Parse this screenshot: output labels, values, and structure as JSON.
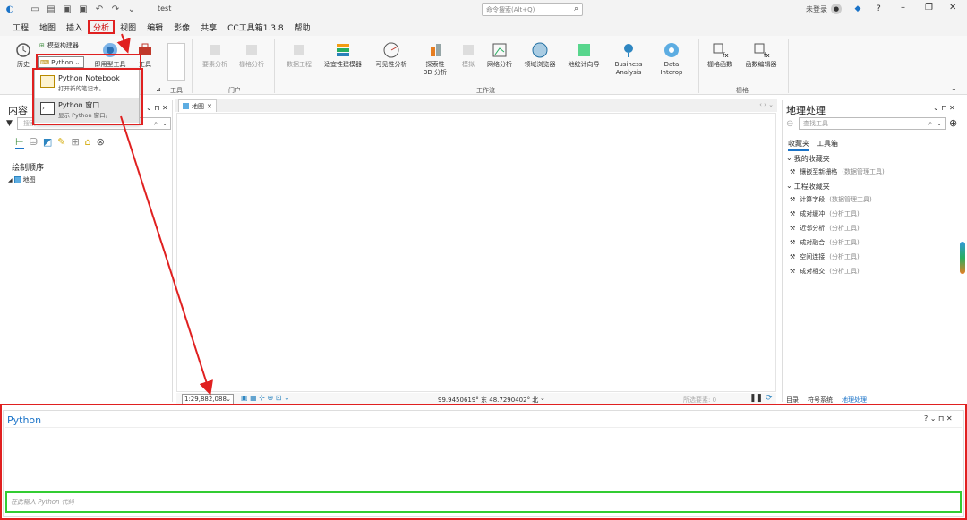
{
  "titlebar": {
    "doc_title": "test",
    "search_placeholder": "命令搜索(Alt+Q)",
    "login": "未登录",
    "help": "?"
  },
  "menubar": {
    "items": [
      "工程",
      "地图",
      "插入",
      "分析",
      "视图",
      "编辑",
      "影像",
      "共享",
      "CC工具箱1.3.8",
      "帮助"
    ],
    "active": "分析"
  },
  "ribbon": {
    "history": "历史",
    "model_builder": "模型构建器",
    "python_dropdown": "Python",
    "ready_tools": "即用型工具",
    "tools": "工具",
    "tools_group": "工具",
    "feature_analysis": "要素分析",
    "raster_analysis": "栅格分析",
    "portal_group": "门户",
    "data_engineering": "数据工程",
    "suitability_modeler": "适宜性建模器",
    "visibility_analysis": "可见性分析",
    "explore_3d": "探索性\n3D 分析",
    "simulate": "模拟",
    "network_analysis": "网络分析",
    "domain_browser": "领域浏览器",
    "geostatistics": "地统计向导",
    "business_analysis": "Business\nAnalysis",
    "data_interop": "Data\nInterop",
    "workflow_group": "工作流",
    "raster_function": "栅格函数",
    "function_editor": "函数编辑器",
    "raster_group": "栅格"
  },
  "python_menu": {
    "notebook_title": "Python Notebook",
    "notebook_desc": "打开新的笔记本。",
    "window_title": "Python 窗口",
    "window_desc": "显示 Python 窗口。"
  },
  "contents": {
    "title": "内容",
    "search_placeholder": "搜索",
    "draw_order": "绘制顺序",
    "map_layer": "地图"
  },
  "map": {
    "tab_label": "地图",
    "scale": "1:29,882,088",
    "coordinates": "99.9450619° 东 48.7290402° 北",
    "selected_features": "所选要素: 0"
  },
  "geoprocessing": {
    "title": "地理处理",
    "search_placeholder": "查找工具",
    "tab_favorites": "收藏夹",
    "tab_toolboxes": "工具箱",
    "my_favorites": "我的收藏夹",
    "project_favorites": "工程收藏夹",
    "my_items": [
      {
        "name": "镶嵌至新栅格",
        "source": "(数据管理工具)"
      }
    ],
    "project_items": [
      {
        "name": "计算字段",
        "source": "(数据管理工具)"
      },
      {
        "name": "成对缓冲",
        "source": "(分析工具)"
      },
      {
        "name": "近邻分析",
        "source": "(分析工具)"
      },
      {
        "name": "成对融合",
        "source": "(分析工具)"
      },
      {
        "name": "空间连接",
        "source": "(分析工具)"
      },
      {
        "name": "成对相交",
        "source": "(分析工具)"
      }
    ],
    "bottom_tabs": [
      "目录",
      "符号系统",
      "地理处理"
    ]
  },
  "python_window": {
    "title": "Python",
    "input_placeholder": "在此输入 Python 代码"
  },
  "colors": {
    "highlight_red": "#e02020",
    "highlight_green": "#33cc33",
    "accent_blue": "#1a73c8"
  }
}
